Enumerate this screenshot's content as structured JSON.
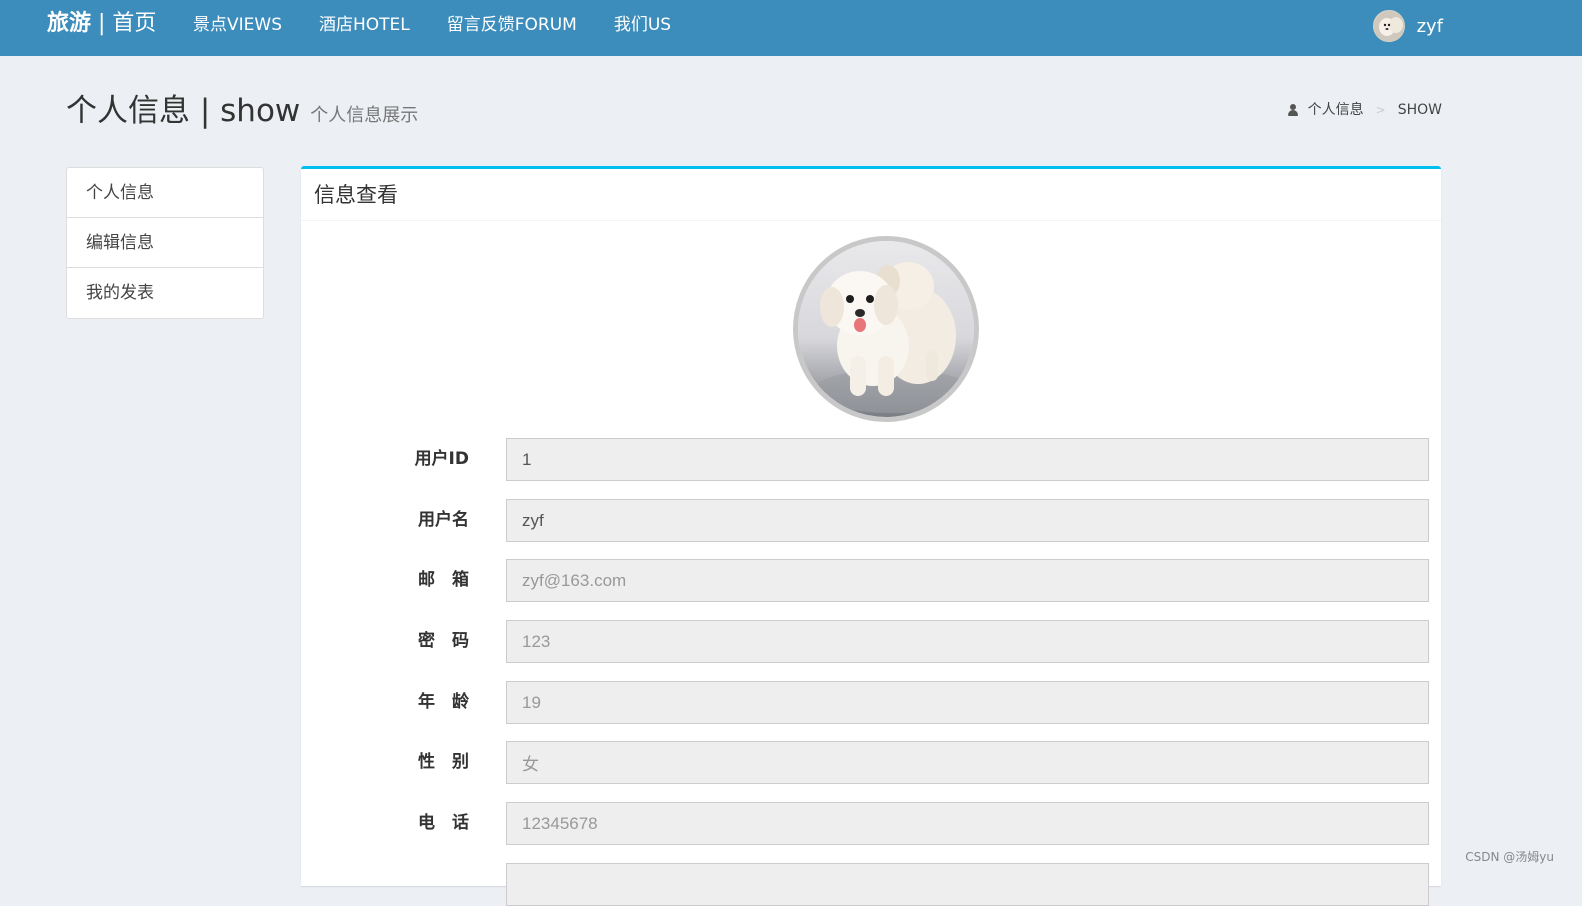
{
  "navbar": {
    "brand_bold": "旅游",
    "brand_rest": " | 首页",
    "items": [
      {
        "label": "景点VIEWS"
      },
      {
        "label": "酒店HOTEL"
      },
      {
        "label": "留言反馈FORUM"
      },
      {
        "label": "我们US"
      }
    ],
    "user_name": "zyf",
    "bg_color": "#3c8dbc"
  },
  "header": {
    "title": "个人信息 | show",
    "subtitle": "个人信息展示",
    "breadcrumb": {
      "icon": "user-icon",
      "parent": "个人信息",
      "separator": ">",
      "current": "SHOW"
    }
  },
  "sidebar": {
    "items": [
      {
        "label": "个人信息"
      },
      {
        "label": "编辑信息"
      },
      {
        "label": "我的发表"
      }
    ]
  },
  "box": {
    "title": "信息查看",
    "accent_color": "#00c0ef"
  },
  "form": {
    "fields": [
      {
        "label": "用户ID",
        "value": "1"
      },
      {
        "label": "用户名",
        "value": "zyf"
      },
      {
        "label": "邮　箱",
        "value": "zyf@163.com"
      },
      {
        "label": "密　码",
        "value": "123"
      },
      {
        "label": "年　龄",
        "value": "19"
      },
      {
        "label": "性　别",
        "value": "女"
      },
      {
        "label": "电　话",
        "value": "12345678"
      }
    ]
  },
  "watermark": "CSDN @汤姆yu"
}
